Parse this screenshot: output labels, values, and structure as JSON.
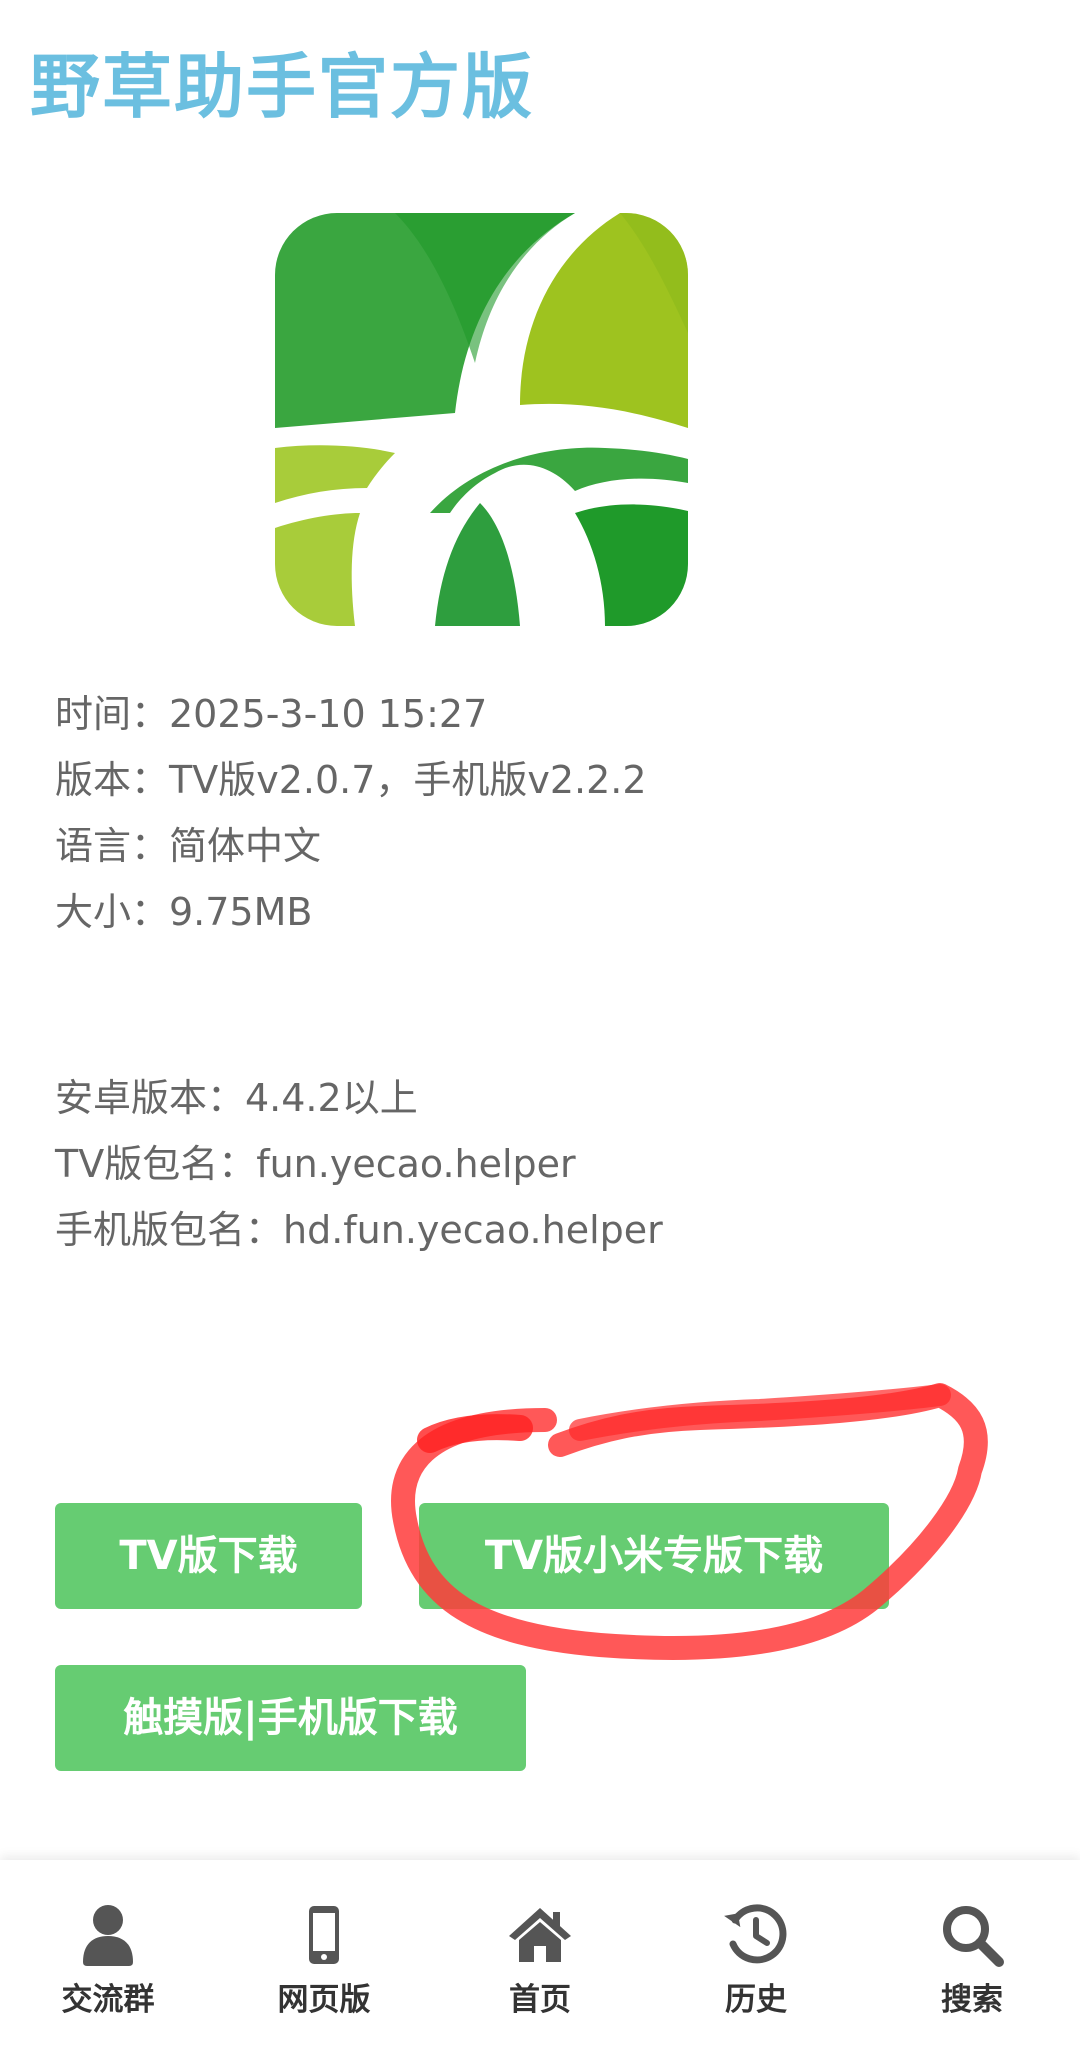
{
  "header": {
    "title": "野草助手官方版"
  },
  "app": {
    "icon": "yecao-logo-icon"
  },
  "info": {
    "time": "时间：2025-3-10 15:27",
    "version": "版本：TV版v2.0.7，手机版v2.2.2",
    "language": "语言：简体中文",
    "size": "大小：9.75MB",
    "android": "安卓版本：4.4.2以上",
    "tv_package": "TV版包名：fun.yecao.helper",
    "mobile_package": "手机版包名：hd.fun.yecao.helper"
  },
  "buttons": {
    "tv_download": "TV版下载",
    "tv_mi_download": "TV版小米专版下载",
    "touch_mobile_download": "触摸版|手机版下载"
  },
  "nav": {
    "items": [
      {
        "label": "交流群",
        "icon": "user-icon"
      },
      {
        "label": "网页版",
        "icon": "mobile-phone-icon"
      },
      {
        "label": "首页",
        "icon": "home-icon"
      },
      {
        "label": "历史",
        "icon": "history-icon"
      },
      {
        "label": "搜索",
        "icon": "search-icon"
      }
    ]
  },
  "colors": {
    "title": "#6bbfe0",
    "button": "#66cc72",
    "annotation": "#ff3b3b",
    "logo_dark_green": "#2e9e3e",
    "logo_light_green": "#9cc524"
  }
}
